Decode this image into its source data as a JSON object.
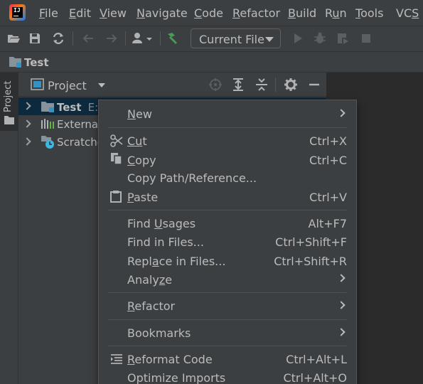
{
  "menubar": {
    "items": [
      {
        "pre": "",
        "mn": "F",
        "post": "ile"
      },
      {
        "pre": "",
        "mn": "E",
        "post": "dit"
      },
      {
        "pre": "",
        "mn": "V",
        "post": "iew"
      },
      {
        "pre": "",
        "mn": "N",
        "post": "avigate"
      },
      {
        "pre": "",
        "mn": "C",
        "post": "ode"
      },
      {
        "pre": "",
        "mn": "R",
        "post": "efactor"
      },
      {
        "pre": "",
        "mn": "B",
        "post": "uild"
      },
      {
        "pre": "R",
        "mn": "u",
        "post": "n"
      },
      {
        "pre": "",
        "mn": "T",
        "post": "ools"
      },
      {
        "pre": "VC",
        "mn": "S",
        "post": ""
      }
    ]
  },
  "toolbar": {
    "run_config": "Current File"
  },
  "breadcrumb": {
    "label": "Test"
  },
  "left_strip": {
    "tab_label": "Project"
  },
  "project_panel": {
    "title": "Project",
    "tree": [
      {
        "name": "Test",
        "suffix": "E:\\"
      },
      {
        "name": "External"
      },
      {
        "name": "Scratche"
      }
    ]
  },
  "context_menu": {
    "items": [
      {
        "pre": "",
        "mn": "N",
        "post": "ew",
        "shortcut": ""
      },
      {
        "pre": "",
        "mn": "Cu",
        "post": "t",
        "shortcut": "Ctrl+X"
      },
      {
        "pre": "",
        "mn": "C",
        "post": "opy",
        "shortcut": "Ctrl+C"
      },
      {
        "pre": "Copy Path/Reference...",
        "mn": "",
        "post": "",
        "shortcut": ""
      },
      {
        "pre": "",
        "mn": "P",
        "post": "aste",
        "shortcut": "Ctrl+V"
      },
      {
        "pre": "Find ",
        "mn": "U",
        "post": "sages",
        "shortcut": "Alt+F7"
      },
      {
        "pre": "Find in ",
        "mn": "",
        "post": "Files...",
        "shortcut": "Ctrl+Shift+F"
      },
      {
        "pre": "Repl",
        "mn": "a",
        "post": "ce in Files...",
        "shortcut": "Ctrl+Shift+R"
      },
      {
        "pre": "Analy",
        "mn": "z",
        "post": "e",
        "shortcut": ""
      },
      {
        "pre": "",
        "mn": "R",
        "post": "efactor",
        "shortcut": ""
      },
      {
        "pre": "Bookmarks",
        "mn": "",
        "post": "",
        "shortcut": ""
      },
      {
        "pre": "",
        "mn": "R",
        "post": "eformat Code",
        "shortcut": "Ctrl+Alt+L"
      },
      {
        "pre": "Optimize Imports",
        "mn": "",
        "post": "",
        "shortcut": "Ctrl+Alt+O"
      }
    ]
  }
}
